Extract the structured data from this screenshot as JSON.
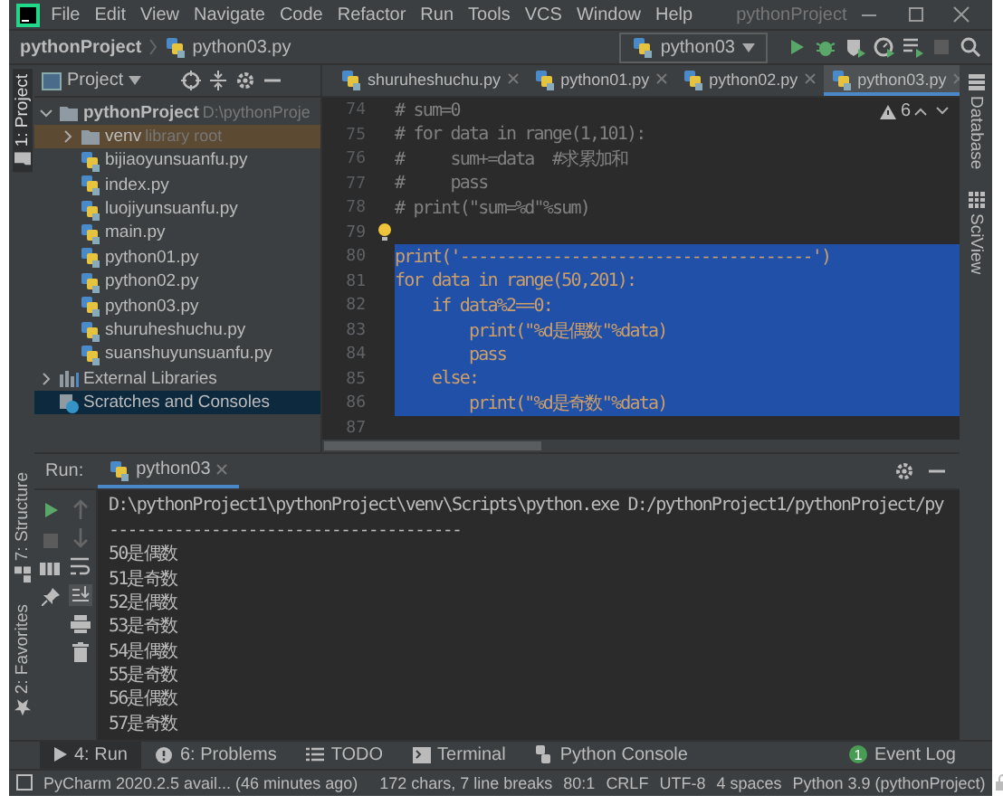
{
  "window": {
    "title": "pythonProject"
  },
  "menu": [
    {
      "label": "File"
    },
    {
      "label": "Edit"
    },
    {
      "label": "View"
    },
    {
      "label": "Navigate"
    },
    {
      "label": "Code"
    },
    {
      "label": "Refactor"
    },
    {
      "label": "Run"
    },
    {
      "label": "Tools"
    },
    {
      "label": "VCS"
    },
    {
      "label": "Window"
    },
    {
      "label": "Help"
    }
  ],
  "breadcrumb": [
    "pythonProject",
    "python03.py"
  ],
  "run_config": "python03",
  "left_stripe": {
    "top": "1: Project",
    "bottom": [
      "7: Structure",
      "2: Favorites"
    ]
  },
  "right_stripe": [
    "Database",
    "SciView"
  ],
  "project_panel": {
    "title": "Project",
    "tree": [
      {
        "label": "pythonProject",
        "note": "D:\\pythonProje",
        "kind": "folder",
        "expanded": true,
        "selected": false,
        "children": [
          {
            "label": "venv",
            "note": "library root",
            "kind": "library-folder",
            "expanded": false,
            "selected": false
          },
          {
            "label": "bijiaoyunsuanfu.py",
            "kind": "file",
            "selected": false
          },
          {
            "label": "index.py",
            "kind": "file",
            "selected": false
          },
          {
            "label": "luojiyunsuanfu.py",
            "kind": "file",
            "selected": false
          },
          {
            "label": "main.py",
            "kind": "file",
            "selected": false
          },
          {
            "label": "python01.py",
            "kind": "file",
            "selected": false
          },
          {
            "label": "python02.py",
            "kind": "file",
            "selected": false
          },
          {
            "label": "python03.py",
            "kind": "file",
            "selected": false
          },
          {
            "label": "shuruheshuchu.py",
            "kind": "file",
            "selected": false
          },
          {
            "label": "suanshuyunsuanfu.py",
            "kind": "file",
            "selected": false
          }
        ]
      },
      {
        "label": "External Libraries",
        "kind": "libraries",
        "expanded": false,
        "selected": false
      },
      {
        "label": "Scratches and Consoles",
        "kind": "scratches",
        "selected": true
      }
    ]
  },
  "editor": {
    "tabs": [
      {
        "label": "shuruheshuchu.py",
        "selected": false
      },
      {
        "label": "python01.py",
        "selected": false
      },
      {
        "label": "python02.py",
        "selected": false
      },
      {
        "label": "python03.py",
        "selected": true
      }
    ],
    "warnings": "6",
    "lines": [
      {
        "number": "74",
        "code": "# sum=0",
        "kind": "comment",
        "selected": false,
        "bulb": false
      },
      {
        "number": "75",
        "code": "# for data in range(1,101):",
        "kind": "comment",
        "selected": false,
        "bulb": false
      },
      {
        "number": "76",
        "code": "#     sum+=data  #求累加和",
        "kind": "comment",
        "selected": false,
        "bulb": false
      },
      {
        "number": "77",
        "code": "#     pass",
        "kind": "comment",
        "selected": false,
        "bulb": false
      },
      {
        "number": "78",
        "code": "# print(\"sum=%d\"%sum)",
        "kind": "comment",
        "selected": false,
        "bulb": false
      },
      {
        "number": "79",
        "kind": "code",
        "selected": false,
        "bulb": true
      },
      {
        "number": "80",
        "code": "print('--------------------------------------')",
        "kind": "code",
        "selected": true,
        "bulb": false
      },
      {
        "number": "81",
        "code": "for data in range(50,201):",
        "kind": "code",
        "selected": true,
        "bulb": false
      },
      {
        "number": "82",
        "code": "    if data%2==0:",
        "kind": "code",
        "selected": true,
        "bulb": false
      },
      {
        "number": "83",
        "code": "        print(\"%d是偶数\"%data)",
        "kind": "code",
        "selected": true,
        "bulb": false
      },
      {
        "number": "84",
        "code": "        pass",
        "kind": "code",
        "selected": true,
        "bulb": false
      },
      {
        "number": "85",
        "code": "    else:",
        "kind": "code",
        "selected": true,
        "bulb": false
      },
      {
        "number": "86",
        "code": "        print(\"%d是奇数\"%data)",
        "kind": "code",
        "selected": true,
        "bulb": false
      },
      {
        "number": "87",
        "kind": "code",
        "selected": false,
        "bulb": false
      }
    ]
  },
  "run_panel": {
    "label": "Run:",
    "tab": "python03",
    "console": [
      "D:\\pythonProject1\\pythonProject\\venv\\Scripts\\python.exe D:/pythonProject1/pythonProject/py",
      "--------------------------------------",
      "50是偶数",
      "51是奇数",
      "52是偶数",
      "53是奇数",
      "54是偶数",
      "55是奇数",
      "56是偶数",
      "57是奇数"
    ]
  },
  "tool_tabs": [
    {
      "label": "4: Run",
      "kind": "run",
      "selected": true
    },
    {
      "label": "6: Problems",
      "kind": "problems",
      "selected": false
    },
    {
      "label": "TODO",
      "kind": "todo",
      "selected": false
    },
    {
      "label": "Terminal",
      "kind": "terminal",
      "selected": false
    },
    {
      "label": "Python Console",
      "kind": "console",
      "selected": false
    }
  ],
  "event_log": {
    "label": "Event Log",
    "badge": "1"
  },
  "status_bar": [
    "PyCharm 2020.2.5 avail... (46 minutes ago)",
    "172 chars, 7 line breaks",
    "80:1",
    "CRLF",
    "UTF-8",
    "4 spaces",
    "Python 3.9 (pythonProject)"
  ]
}
